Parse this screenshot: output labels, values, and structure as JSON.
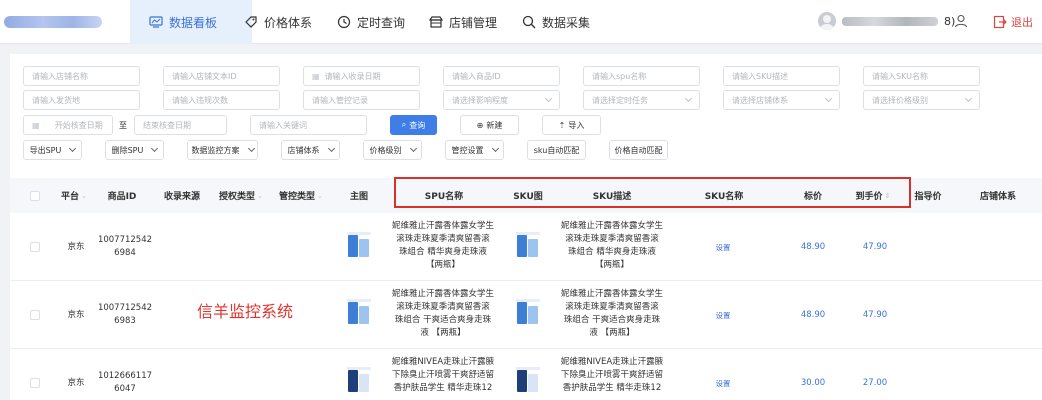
{
  "nav": {
    "items": [
      {
        "label": "数据看板",
        "icon": "dashboard-icon",
        "active": true
      },
      {
        "label": "价格体系",
        "icon": "tag-icon"
      },
      {
        "label": "定时查询",
        "icon": "clock-icon"
      },
      {
        "label": "店铺管理",
        "icon": "store-icon"
      },
      {
        "label": "数据采集",
        "icon": "search-icon"
      }
    ],
    "user_suffix": "8)",
    "logout_label": "退出"
  },
  "filters": {
    "row1": [
      "请输入店铺名称",
      "请输入店铺文本ID",
      "请输入收录日期",
      "请输入商品ID",
      "请输入spu名称",
      "请输入SKU描述",
      "请输入SKU名称"
    ],
    "row2": [
      "请输入发货地",
      "请输入违规次数",
      "请输入管控记录",
      "请选择影响程度",
      "请选择定时任务",
      "请选择店铺体系",
      "请选择价格级别"
    ],
    "start_date": "开始核查日期",
    "to": "至",
    "end_date": "结束核查日期",
    "keyword": "请输入关键词",
    "query_label": "查询",
    "new_label": "新建",
    "import_label": "导入"
  },
  "actions": [
    "导出SPU",
    "删除SPU",
    "数据监控方案",
    "店铺体系",
    "价格级别",
    "管控设置",
    "sku自动匹配",
    "价格自动匹配"
  ],
  "table": {
    "headers": [
      "平台",
      "商品ID",
      "收录来源",
      "授权类型",
      "管控类型",
      "主图",
      "SPU名称",
      "SKU图",
      "SKU描述",
      "SKU名称",
      "标价",
      "到手价",
      "指导价",
      "店铺体系"
    ],
    "rows": [
      {
        "platform": "京东",
        "id_line1": "1007712542",
        "id_line2": "6984",
        "spu_lines": [
          "妮维雅止汗露香体露女学生",
          "滚珠走珠夏季清爽留香滚",
          "珠组合 精华爽身走珠液",
          "【两瓶】"
        ],
        "sku_lines": [
          "妮维雅止汗露香体露女学生",
          "滚珠走珠夏季清爽留香滚",
          "珠组合 精华爽身走珠液",
          "【两瓶】"
        ],
        "sku_name": "设置",
        "list_price": "48.90",
        "final_price": "47.90"
      },
      {
        "platform": "京东",
        "id_line1": "1007712542",
        "id_line2": "6983",
        "spu_lines": [
          "妮维雅止汗露香体露女学生",
          "滚珠走珠夏季清爽留香滚",
          "珠组合 干爽适合爽身走珠",
          "液 【两瓶】"
        ],
        "sku_lines": [
          "妮维雅止汗露香体露女学生",
          "滚珠走珠夏季清爽留香滚",
          "珠组合 干爽适合爽身走珠",
          "液 【两瓶】"
        ],
        "sku_name": "设置",
        "list_price": "48.90",
        "final_price": "47.90"
      },
      {
        "platform": "京东",
        "id_line1": "1012666117",
        "id_line2": "6047",
        "spu_lines": [
          "妮维雅NIVEA走珠止汗露腋",
          "下除臭止汗喷雾干爽舒适留",
          "香护肤品学生 精华走珠12"
        ],
        "sku_lines": [
          "妮维雅NIVEA走珠止汗露腋",
          "下除臭止汗喷雾干爽舒适留",
          "香护肤品学生 精华走珠12"
        ],
        "sku_name": "设置",
        "list_price": "30.00",
        "final_price": "27.00"
      }
    ]
  },
  "watermark": "信羊监控系统"
}
